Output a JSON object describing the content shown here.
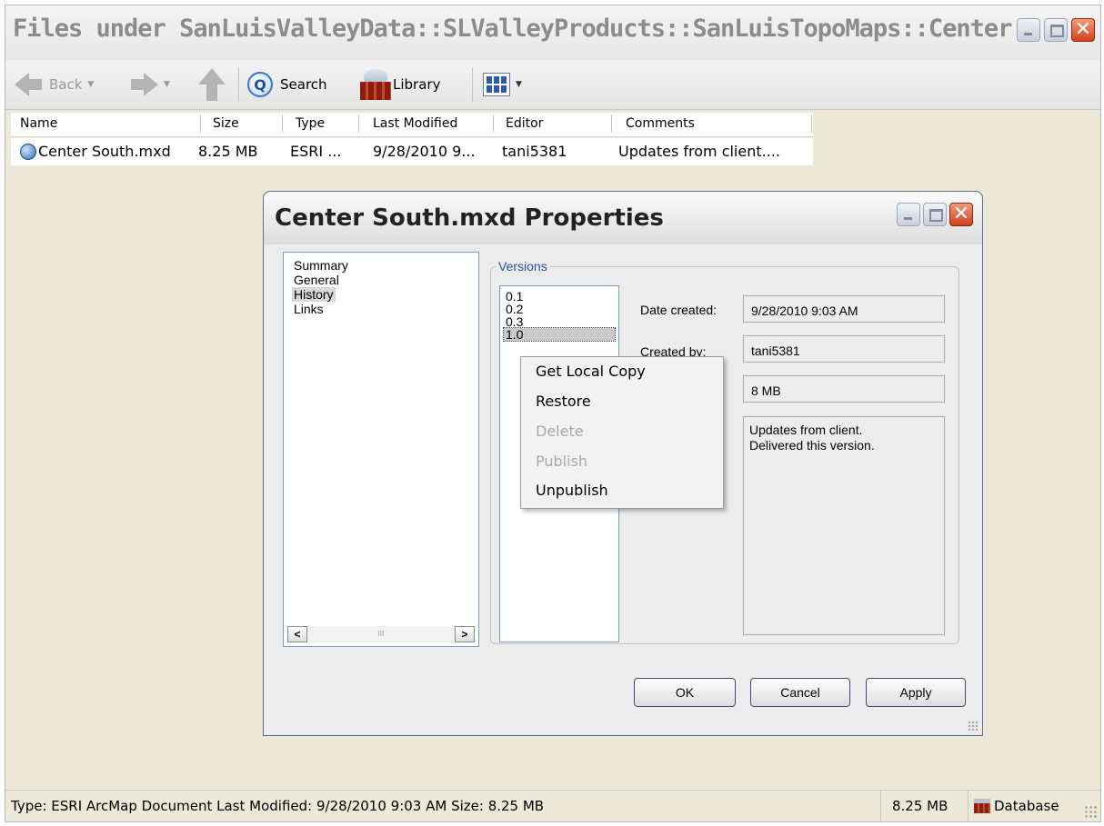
{
  "window": {
    "title": "Files under SanLuisValleyData::SLValleyProducts::SanLuisTopoMaps::Center ..."
  },
  "toolbar": {
    "back_label": "Back",
    "search_label": "Search",
    "library_label": "Library"
  },
  "file_list": {
    "columns": [
      "Name",
      "Size",
      "Type",
      "Last Modified",
      "Editor",
      "Comments"
    ],
    "rows": [
      {
        "name": "Center South.mxd",
        "size": "8.25 MB",
        "type": "ESRI ...",
        "last_modified": "9/28/2010 9...",
        "editor": "tani5381",
        "comments": "Updates from client...."
      }
    ]
  },
  "status_bar": {
    "text": "Type: ESRI ArcMap Document Last Modified: 9/28/2010 9:03 AM Size: 8.25 MB",
    "size": "8.25 MB",
    "location": "Database"
  },
  "dialog": {
    "title": "Center South.mxd Properties",
    "nav_items": [
      "Summary",
      "General",
      "History",
      "Links"
    ],
    "selected_nav": "History",
    "versions_legend": "Versions",
    "versions": [
      "0.1",
      "0.2",
      "0.3",
      "1.0"
    ],
    "selected_version": "1.0",
    "labels": {
      "date_created": "Date created:",
      "created_by": "Created by:"
    },
    "values": {
      "date_created": "9/28/2010 9:03 AM",
      "created_by": "tani5381",
      "size": "8 MB",
      "comments_line1": "Updates from client.",
      "comments_line2": "Delivered this version."
    },
    "buttons": {
      "ok": "OK",
      "cancel": "Cancel",
      "apply": "Apply"
    }
  },
  "context_menu": {
    "items": [
      {
        "label": "Get Local Copy",
        "enabled": true
      },
      {
        "label": "Restore",
        "enabled": true
      },
      {
        "label": "Delete",
        "enabled": false
      },
      {
        "label": "Publish",
        "enabled": false
      },
      {
        "label": "Unpublish",
        "enabled": true
      }
    ]
  }
}
